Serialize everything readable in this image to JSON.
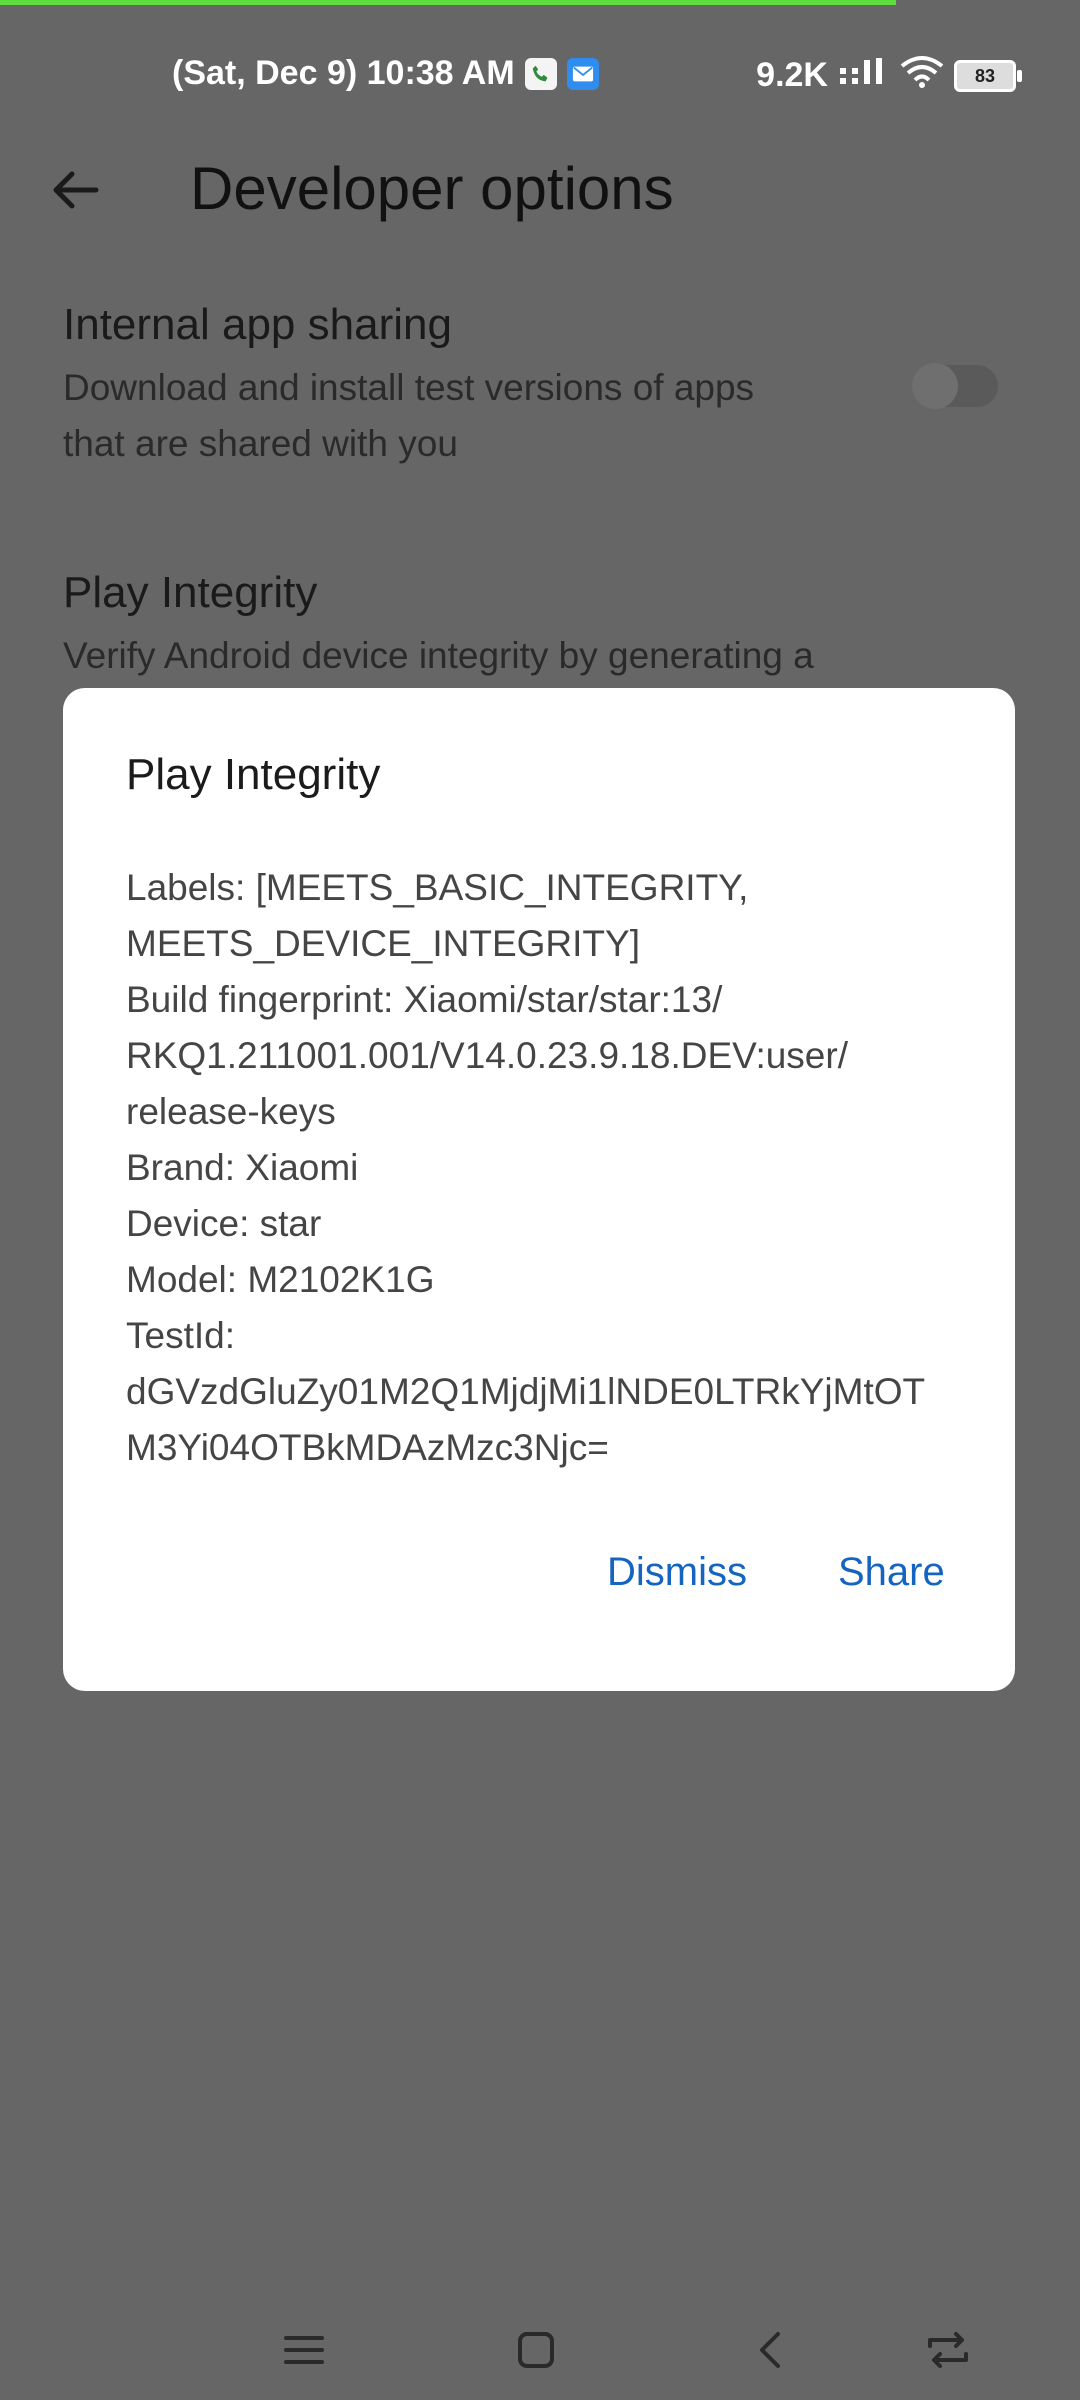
{
  "status_bar": {
    "datetime": "(Sat, Dec 9) 10:38 AM",
    "data_speed": "9.2K",
    "battery": "83"
  },
  "header": {
    "title": "Developer options"
  },
  "settings": [
    {
      "title": "Internal app sharing",
      "desc_lines": [
        "Download and install test versions of apps",
        "that are shared with you"
      ],
      "toggle_on": false
    },
    {
      "title": "Play Integrity",
      "desc_lines": [
        "Verify Android device integrity by generating a Play"
      ]
    }
  ],
  "dialog": {
    "title": "Play Integrity",
    "lines": [
      "Labels: [MEETS_BASIC_INTEGRITY,",
      "MEETS_DEVICE_INTEGRITY]",
      "Build fingerprint: Xiaomi/star/star:13/",
      "RKQ1.211001.001/V14.0.23.9.18.DEV:user/",
      "release-keys",
      "Brand: Xiaomi",
      "Device: star",
      "Model: M2102K1G",
      "TestId:",
      "dGVzdGluZy01M2Q1MjdjMi1lNDE0LTRkYjMtOT",
      "M3Yi04OTBkMDAzMzc3Njc="
    ],
    "dismiss_label": "Dismiss",
    "share_label": "Share"
  },
  "colors": {
    "accent": "#1565c0",
    "scrim": "#666666",
    "progress": "#5dde3d"
  }
}
